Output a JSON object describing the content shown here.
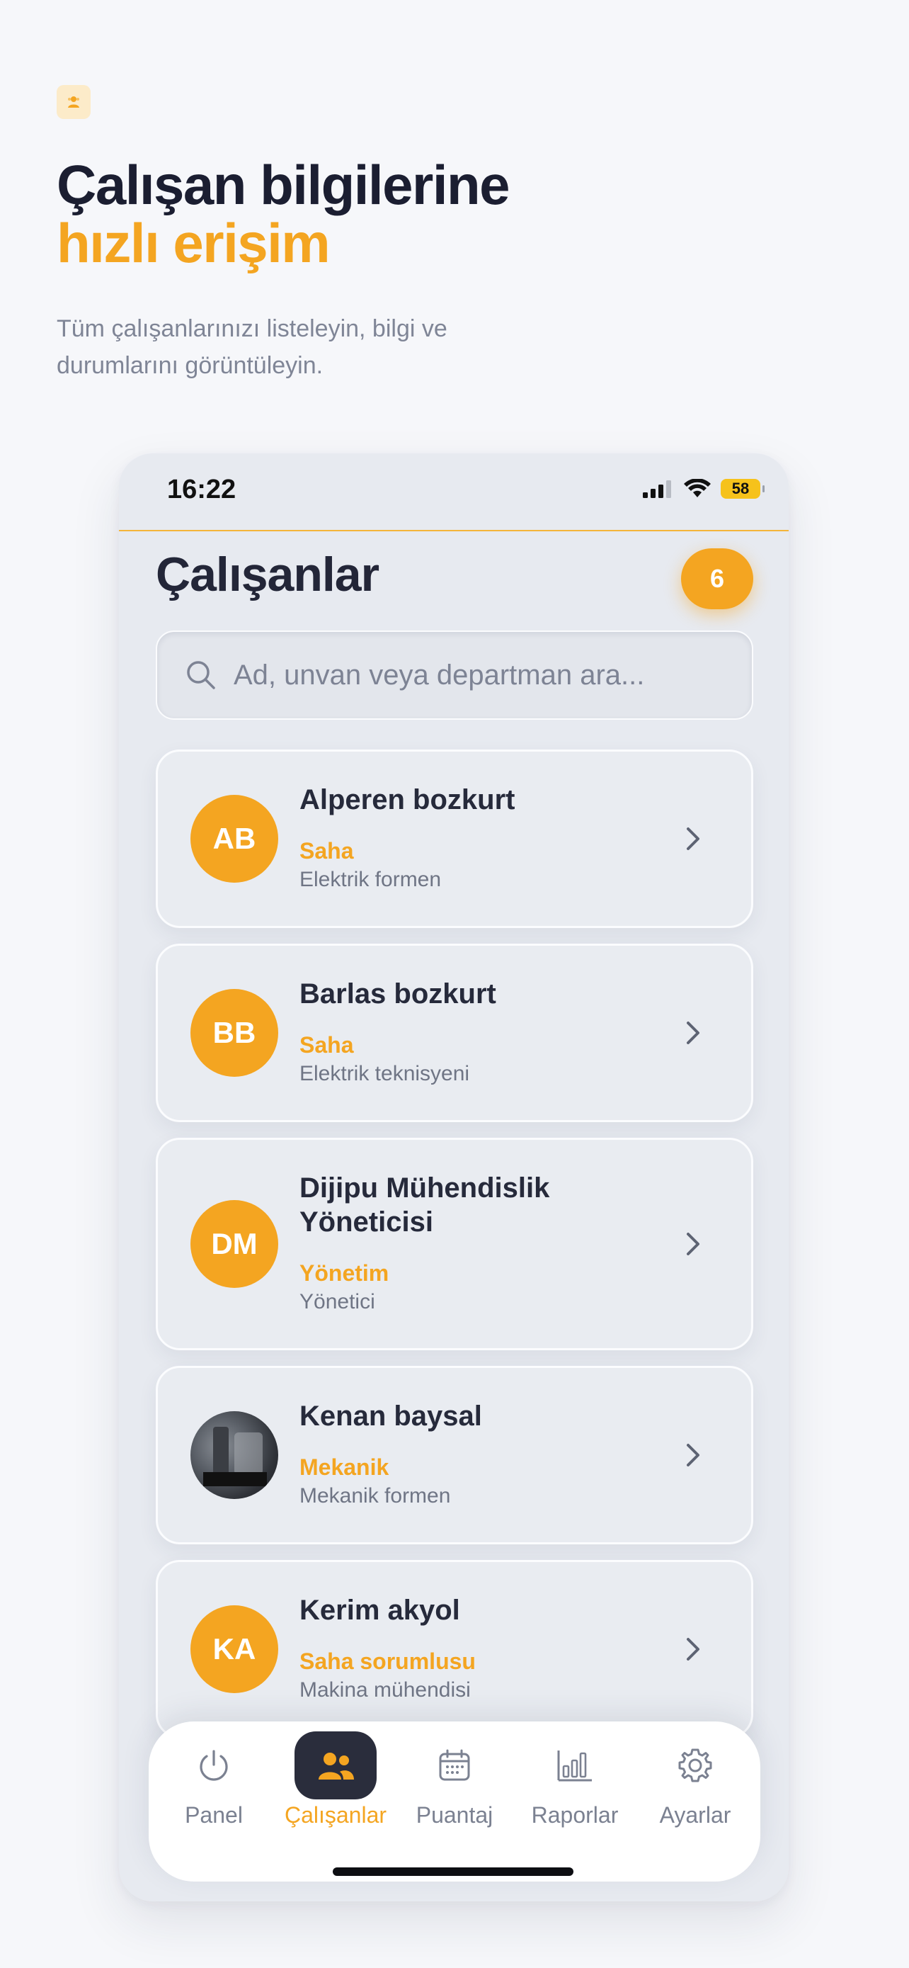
{
  "hero": {
    "icon": "people-icon",
    "title": "Çalışan bilgilerine",
    "title_accent": "hızlı erişim",
    "subtitle": "Tüm çalışanlarınızı listeleyin, bilgi ve durumlarını görüntüleyin."
  },
  "status_bar": {
    "time": "16:22",
    "battery": "58"
  },
  "screen": {
    "title": "Çalışanlar",
    "count": "6"
  },
  "search": {
    "placeholder": "Ad, unvan veya departman ara...",
    "value": ""
  },
  "employees": [
    {
      "initials": "AB",
      "name": "Alperen bozkurt",
      "department": "Saha",
      "title": "Elektrik formen",
      "photo": false
    },
    {
      "initials": "BB",
      "name": "Barlas bozkurt",
      "department": "Saha",
      "title": "Elektrik teknisyeni",
      "photo": false
    },
    {
      "initials": "DM",
      "name": "Dijipu Mühendislik Yöneticisi",
      "department": "Yönetim",
      "title": "Yönetici",
      "photo": false
    },
    {
      "initials": "",
      "name": "Kenan baysal",
      "department": "Mekanik",
      "title": "Mekanik formen",
      "photo": true
    },
    {
      "initials": "KA",
      "name": "Kerim akyol",
      "department": "Saha sorumlusu",
      "title": "Makina mühendisi",
      "photo": false
    }
  ],
  "nav": {
    "items": [
      {
        "label": "Panel",
        "icon": "power-icon",
        "active": false
      },
      {
        "label": "Çalışanlar",
        "icon": "people-icon",
        "active": true
      },
      {
        "label": "Puantaj",
        "icon": "calendar-icon",
        "active": false
      },
      {
        "label": "Raporlar",
        "icon": "bar-chart-icon",
        "active": false
      },
      {
        "label": "Ayarlar",
        "icon": "gear-icon",
        "active": false
      }
    ]
  },
  "colors": {
    "accent": "#f4a521",
    "dark": "#1b1e31",
    "muted": "#7f8596",
    "background": "#f6f7fa"
  }
}
